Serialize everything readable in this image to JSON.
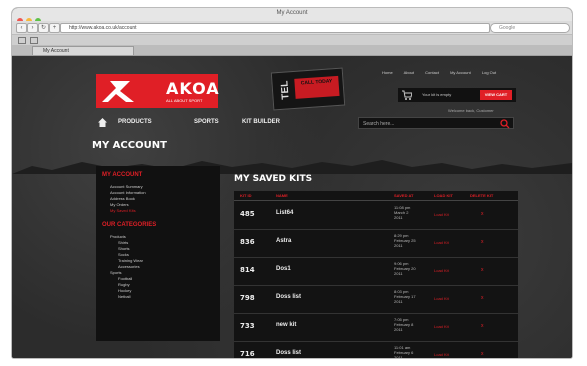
{
  "window": {
    "title": "My Account"
  },
  "browser": {
    "url": "http://www.akoa.co.uk/account",
    "search_placeholder": "Google",
    "tab_label": "My Account"
  },
  "site": {
    "logo_text": "AKOA",
    "logo_tagline": "ALL ABOUT SPORT",
    "tel_label": "TEL",
    "tel_badge": "CALL TODAY",
    "top_links": [
      "Home",
      "About",
      "Contact",
      "My Account",
      "Log Out"
    ],
    "cart_text": "Your kit is empty",
    "view_cart": "VIEW CART",
    "welcome": "Welcome back, Customer",
    "nav": [
      "PRODUCTS",
      "SPORTS",
      "KIT BUILDER"
    ],
    "search_placeholder": "Search here..."
  },
  "account": {
    "title": "MY ACCOUNT",
    "sidebar": {
      "heading1": "MY ACCOUNT",
      "links": [
        "Account Summary",
        "Account Information",
        "Address Book",
        "My Orders",
        "My Saved Kits"
      ],
      "heading2": "OUR CATEGORIES",
      "categories": [
        "Products",
        "Shirts",
        "Shorts",
        "Socks",
        "Training Wear",
        "Accessories",
        "Sports",
        "Football",
        "Rugby",
        "Hockey",
        "Netball"
      ]
    }
  },
  "kits": {
    "title": "MY SAVED KITS",
    "headers": [
      "KIT ID",
      "NAME",
      "SAVED AT",
      "LOAD KIT",
      "DELETE KIT"
    ],
    "rows": [
      {
        "id": "485",
        "name": "List64",
        "date": [
          "11:08 pm",
          "March 2",
          "2011"
        ],
        "load": "Load Kit",
        "del": "x"
      },
      {
        "id": "836",
        "name": "Astra",
        "date": [
          "8:29 pm",
          "February 25",
          "2011"
        ],
        "load": "Load Kit",
        "del": "x"
      },
      {
        "id": "814",
        "name": "Dos1",
        "date": [
          "9:06 pm",
          "February 20",
          "2011"
        ],
        "load": "Load Kit",
        "del": "x"
      },
      {
        "id": "798",
        "name": "Doss list",
        "date": [
          "8:03 pm",
          "February 17",
          "2011"
        ],
        "load": "Load Kit",
        "del": "x"
      },
      {
        "id": "733",
        "name": "new kit",
        "date": [
          "7:05 pm",
          "February 8",
          "2011"
        ],
        "load": "Load Kit",
        "del": "x"
      },
      {
        "id": "716",
        "name": "Doss list",
        "date": [
          "11:01 am",
          "February 6",
          "2011"
        ],
        "load": "Load Kit",
        "del": "x"
      }
    ]
  },
  "colors": {
    "accent": "#e01f26",
    "page_bg": "#2c2c2c",
    "panel_bg": "#131313"
  }
}
